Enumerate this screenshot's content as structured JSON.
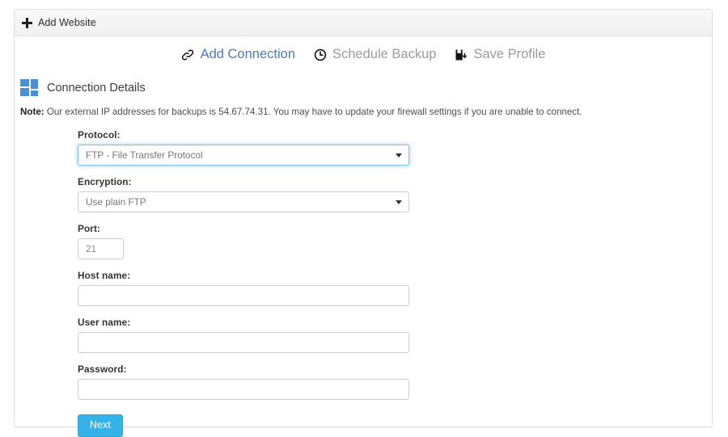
{
  "panel": {
    "header": {
      "icon": "plus-icon",
      "label": "Add Website"
    }
  },
  "nav": {
    "items": [
      {
        "label": "Add Connection",
        "icon": "chain-link-icon",
        "state": "active"
      },
      {
        "label": "Schedule Backup",
        "icon": "clock-icon",
        "state": "muted"
      },
      {
        "label": "Save Profile",
        "icon": "floppy-save-icon",
        "state": "muted"
      }
    ]
  },
  "section": {
    "icon": "grid-blocks-icon",
    "title": "Connection Details"
  },
  "note": {
    "prefix": "Note:",
    "text": " Our external IP addresses for backups is 54.67.74.31. You may have to update your firewall settings if you are unable to connect."
  },
  "form": {
    "fields": {
      "protocol": {
        "label": "Protocol:",
        "value": "FTP - File Transfer Protocol",
        "focused": true
      },
      "encryption": {
        "label": "Encryption:",
        "value": "Use plain FTP",
        "focused": false
      },
      "port": {
        "label": "Port:",
        "value": "21",
        "placeholder": ""
      },
      "hostname": {
        "label": "Host name:",
        "value": "",
        "placeholder": ""
      },
      "username": {
        "label": "User name:",
        "value": "",
        "placeholder": ""
      },
      "password": {
        "label": "Password:",
        "value": "",
        "placeholder": ""
      }
    },
    "submit_label": "Next"
  },
  "colors": {
    "accent_blue": "#35b2e8",
    "link_blue": "#4b7cb5",
    "icon_blue": "#4a90d9",
    "muted_gray": "#9b9b9b",
    "panel_border": "#dddddd"
  }
}
